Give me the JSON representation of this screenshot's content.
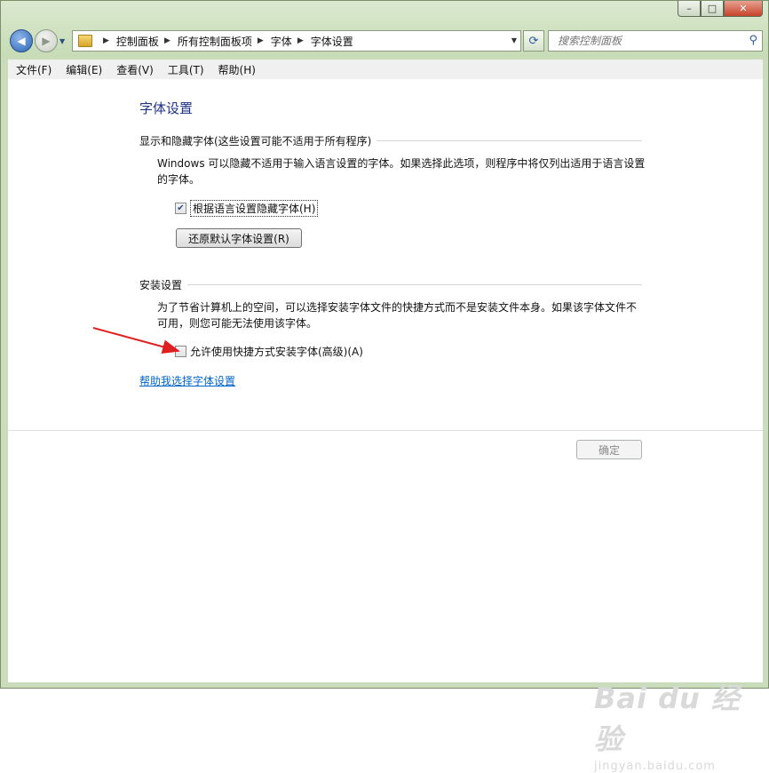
{
  "window": {
    "controls": [
      "minimize",
      "maximize",
      "close"
    ],
    "control_glyphs": {
      "minimize": "–",
      "maximize": "□",
      "close": "✕"
    }
  },
  "nav": {
    "back_glyph": "◀",
    "forward_glyph": "▶",
    "breadcrumb": [
      "控制面板",
      "所有控制面板项",
      "字体",
      "字体设置"
    ],
    "search_placeholder": "搜索控制面板"
  },
  "menu": [
    "文件(F)",
    "编辑(E)",
    "查看(V)",
    "工具(T)",
    "帮助(H)"
  ],
  "page": {
    "title": "字体设置",
    "section1": {
      "heading": "显示和隐藏字体(这些设置可能不适用于所有程序)",
      "description": "Windows 可以隐藏不适用于输入语言设置的字体。如果选择此选项，则程序中将仅列出适用于语言设置的字体。",
      "checkbox_label": "根据语言设置隐藏字体(H)",
      "checkbox_checked": true,
      "restore_button": "还原默认字体设置(R)"
    },
    "section2": {
      "heading": "安装设置",
      "description": "为了节省计算机上的空间，可以选择安装字体文件的快捷方式而不是安装文件本身。如果该字体文件不可用，则您可能无法使用该字体。",
      "checkbox_label": "允许使用快捷方式安装字体(高级)(A)",
      "checkbox_checked": false
    },
    "help_link": "帮助我选择字体设置",
    "ok_button": "确定"
  },
  "annotation": {
    "arrow_color": "#e02020"
  },
  "watermark": {
    "main": "Bai du 经验",
    "sub": "jingyan.baidu.com"
  }
}
